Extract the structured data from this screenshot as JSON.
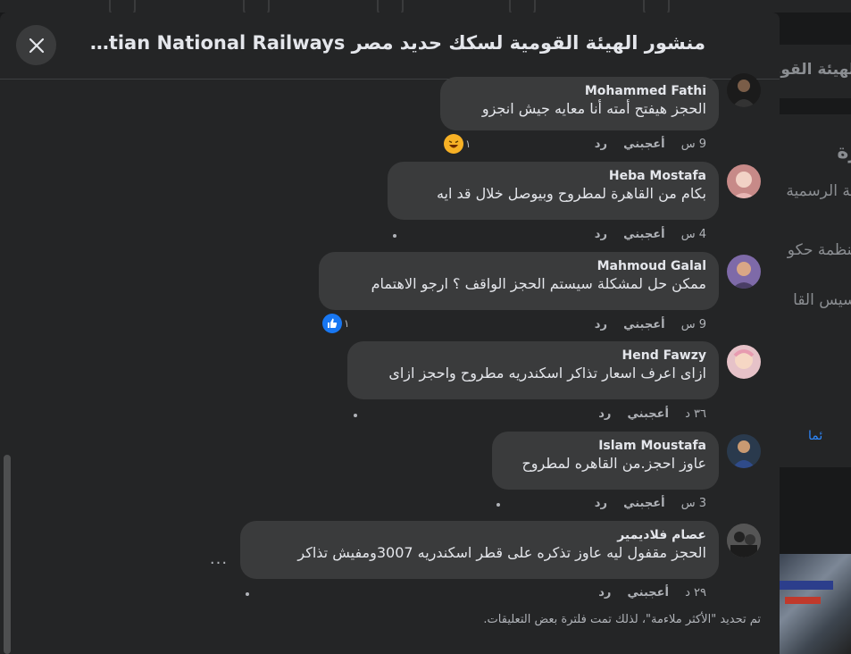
{
  "modal": {
    "title": "منشور الهيئة القومية لسكك حديد مصر Egyptian National Railways",
    "close_icon": "close-icon"
  },
  "background_page": {
    "side_texts": [
      "الهيئة القومية",
      "رة",
      "حة الرسمية",
      "منظمة حكو",
      "أسيس القا",
      "ئما"
    ]
  },
  "comments": [
    {
      "author": "Mohammed Fathi",
      "text": "الحجز هيفتح أمته أنا معايه جيش انجزو",
      "time": "9 س",
      "like": "أعجبني",
      "reply": "رد",
      "reaction_count": "١",
      "reaction": "haha-emoji"
    },
    {
      "author": "Heba Mostafa",
      "text": "بكام من القاهرة لمطروح وبيوصل خلال قد ايه",
      "time": "4 س",
      "like": "أعجبني",
      "reply": "رد"
    },
    {
      "author": "Mahmoud Galal",
      "text": "ممكن حل لمشكلة سيستم الحجز الواقف ؟ ارجو الاهتمام",
      "time": "9 س",
      "like": "أعجبني",
      "reply": "رد",
      "reaction_count": "١",
      "reaction": "like-thumb"
    },
    {
      "author": "Hend Fawzy",
      "text": "ازاى اعرف اسعار تذاكر اسكندريه مطروح واحجز ازاى",
      "time": "٣٦ د",
      "like": "أعجبني",
      "reply": "رد"
    },
    {
      "author": "Islam Moustafa",
      "text": "عاوز احجز.من القاهره لمطروح",
      "time": "3 س",
      "like": "أعجبني",
      "reply": "رد"
    },
    {
      "author": "عصام فلاديمير",
      "text": "الحجز مقفول ليه عاوز تذكره على قطر اسكندريه 3007ومفيش تذاكر",
      "time": "٢٩ د",
      "like": "أعجبني",
      "reply": "رد"
    }
  ],
  "more_options": "...",
  "footer_note": "تم تحديد \"الأكثر ملاءمة\"، لذلك تمت فلترة بعض التعليقات.",
  "colors": {
    "modal_bg": "#242526",
    "bubble_bg": "#3a3b3c",
    "text": "#e4e6eb",
    "muted": "#b0b3b8",
    "like_blue": "#1877f2"
  }
}
